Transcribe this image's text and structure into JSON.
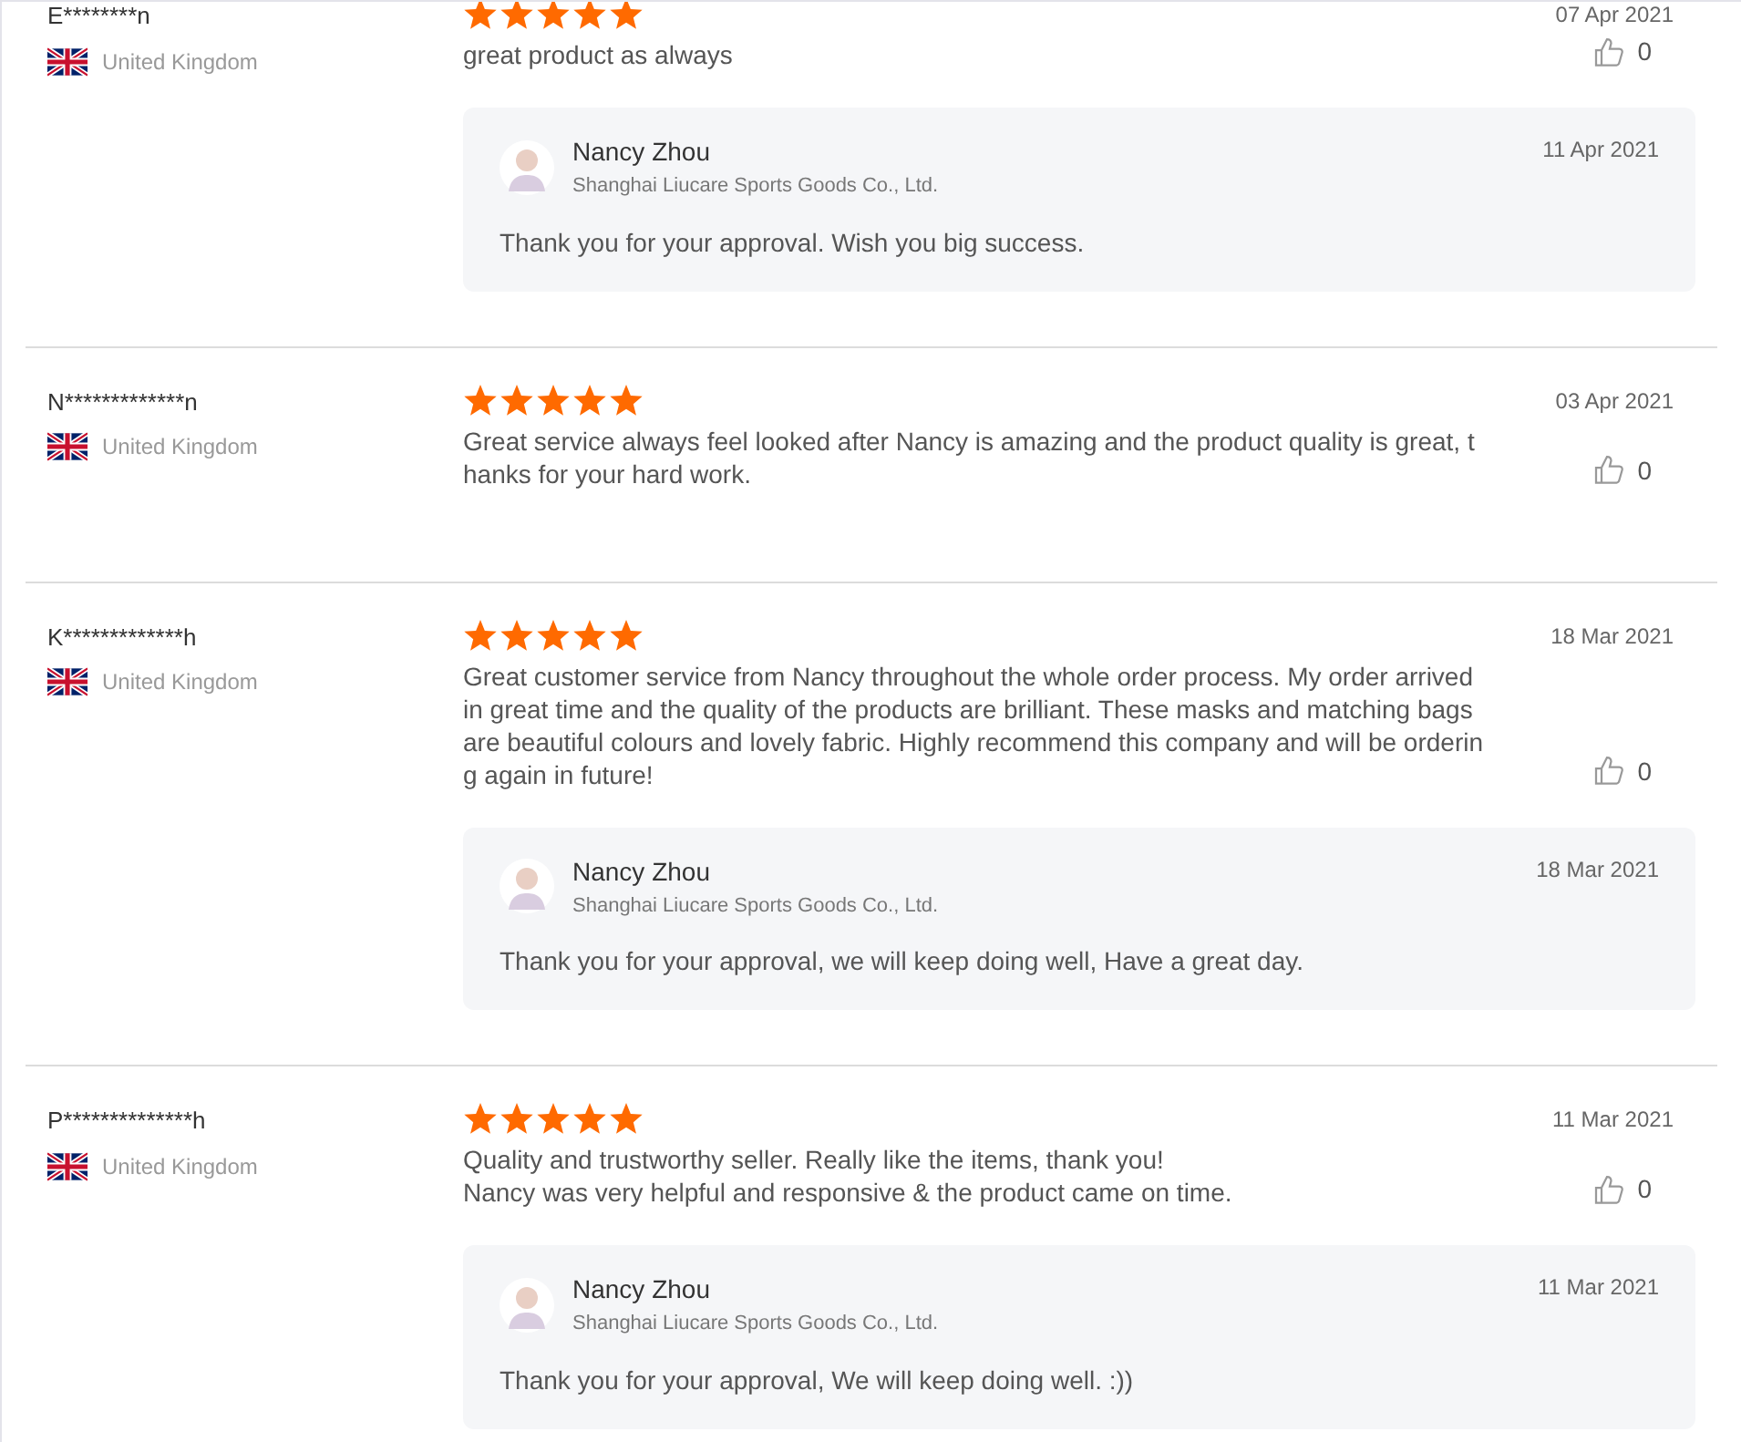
{
  "reviews": [
    {
      "name": "E********n",
      "country": "United Kingdom",
      "stars": 5,
      "text": "great product as always",
      "date": "07 Apr 2021",
      "likes": "0",
      "reply": {
        "name": "Nancy Zhou",
        "company": "Shanghai Liucare Sports Goods Co., Ltd.",
        "date": "11 Apr 2021",
        "text": "Thank you for your approval. Wish you big success."
      }
    },
    {
      "name": "N*************n",
      "country": "United Kingdom",
      "stars": 5,
      "text": "Great service always feel looked after Nancy is amazing and the product quality is great, thanks for your hard work.",
      "date": "03 Apr 2021",
      "likes": "0"
    },
    {
      "name": "K*************h",
      "country": "United Kingdom",
      "stars": 5,
      "text": "Great customer service from Nancy throughout the whole order process. My order arrived in great time and the quality of the products are brilliant. These masks and matching bags are beautiful colours and lovely fabric. Highly recommend this company and will be ordering again in future!",
      "date": "18 Mar 2021",
      "likes": "0",
      "reply": {
        "name": "Nancy Zhou",
        "company": "Shanghai Liucare Sports Goods Co., Ltd.",
        "date": "18 Mar 2021",
        "text": "Thank you for your approval, we will keep doing well, Have a great day."
      }
    },
    {
      "name": "P**************h",
      "country": "United Kingdom",
      "stars": 5,
      "text": "Quality and trustworthy seller. Really like the items, thank you!\nNancy was very helpful and responsive & the product came on time.",
      "date": "11 Mar 2021",
      "likes": "0",
      "reply": {
        "name": "Nancy Zhou",
        "company": "Shanghai Liucare Sports Goods Co., Ltd.",
        "date": "11 Mar 2021",
        "text": "Thank you for your approval, We will keep doing well. :))"
      }
    }
  ]
}
